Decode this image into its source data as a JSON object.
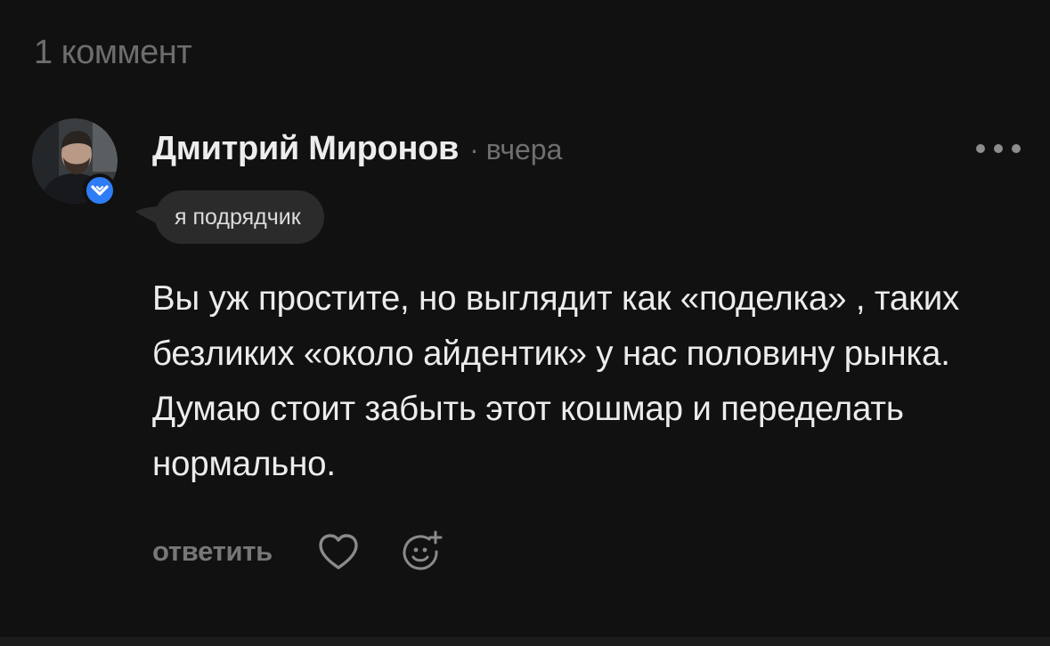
{
  "comments_header": {
    "count_label": "1 коммент"
  },
  "comment": {
    "author": {
      "name": "Дмитрий Миронов",
      "avatar_icon": "user-photo-avatar",
      "verified_icon": "verified-badge-icon",
      "verified_color": "#2f7df6"
    },
    "separator": "·",
    "time": "вчера",
    "role_tag": "я подрядчик",
    "text": "Вы уж простите, но выглядит как «поделка» , таких безликих «около айдентик» у нас половину рынка. Думаю стоит забыть этот кошмар и переделать нормально.",
    "actions": {
      "reply_label": "ответить",
      "like_icon": "heart-icon",
      "reaction_icon": "add-reaction-icon"
    },
    "more_icon": "more-dots-icon"
  },
  "colors": {
    "background": "#111111",
    "tag_background": "#2b2b2b",
    "muted_text": "#6f6f6f"
  }
}
